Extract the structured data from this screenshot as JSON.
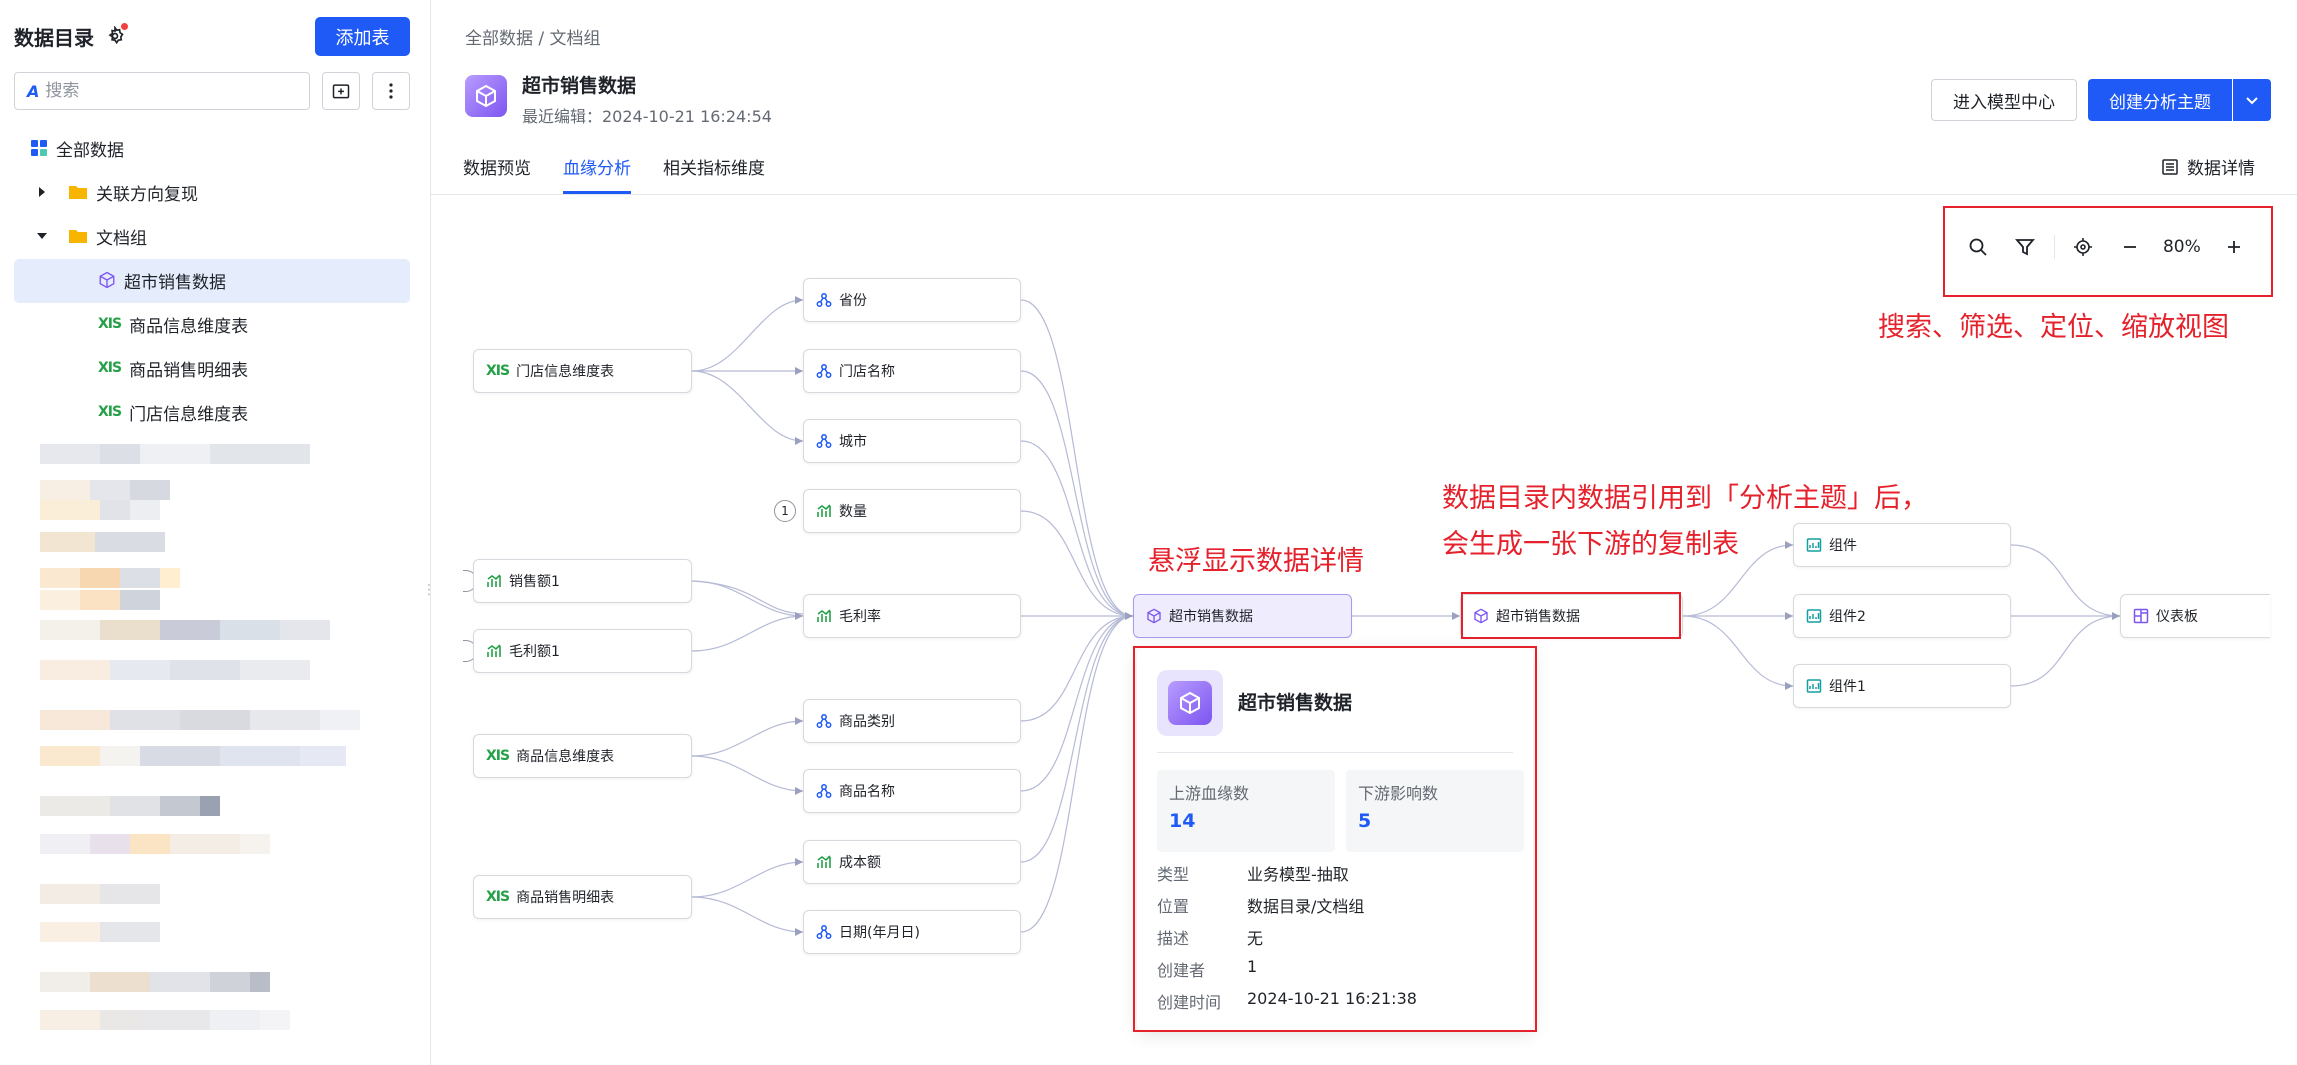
{
  "sidebar": {
    "title": "数据目录",
    "add_button": "添加表",
    "search_placeholder": "搜索",
    "tree": [
      {
        "label": "全部数据"
      },
      {
        "label": "关联方向复现"
      },
      {
        "label": "文档组"
      },
      {
        "label": "超市销售数据"
      },
      {
        "label": "商品信息维度表"
      },
      {
        "label": "商品销售明细表"
      },
      {
        "label": "门店信息维度表"
      }
    ],
    "xls_icon_text": "XIS"
  },
  "header": {
    "breadcrumb": "全部数据 / 文档组",
    "title": "超市销售数据",
    "subtitle": "最近编辑：2024-10-21 16:24:54",
    "btn_model": "进入模型中心",
    "btn_create": "创建分析主题"
  },
  "tabs": [
    {
      "label": "数据预览",
      "active": false
    },
    {
      "label": "血缘分析",
      "active": true
    },
    {
      "label": "相关指标维度",
      "active": false
    }
  ],
  "detail_link": "数据详情",
  "toolbar": {
    "zoom": "80%"
  },
  "annotations": {
    "toolbar_note": "搜索、筛选、定位、缩放视图",
    "hover_note": "悬浮显示数据详情",
    "copy_note_1": "数据目录内数据引用到「分析主题」后，",
    "copy_note_2": "会生成一张下游的复制表"
  },
  "graph": {
    "sources": [
      {
        "label": "门店信息维度表"
      },
      {
        "label": "销售额1"
      },
      {
        "label": "毛利额1"
      },
      {
        "label": "商品信息维度表"
      },
      {
        "label": "商品销售明细表"
      }
    ],
    "fields": [
      {
        "label": "省份"
      },
      {
        "label": "门店名称"
      },
      {
        "label": "城市"
      },
      {
        "label": "数量"
      },
      {
        "label": "毛利率"
      },
      {
        "label": "商品类别"
      },
      {
        "label": "商品名称"
      },
      {
        "label": "成本额"
      },
      {
        "label": "日期(年月日)"
      }
    ],
    "count_badge": "1",
    "center": "超市销售数据",
    "copy": "超市销售数据",
    "components": [
      {
        "label": "组件"
      },
      {
        "label": "组件2"
      },
      {
        "label": "组件1"
      }
    ],
    "dashboard": "仪表板"
  },
  "popup": {
    "title": "超市销售数据",
    "upstream_label": "上游血缘数",
    "upstream_value": "14",
    "downstream_label": "下游影响数",
    "downstream_value": "5",
    "rows": [
      {
        "k": "类型",
        "v": "业务模型-抽取"
      },
      {
        "k": "位置",
        "v": "数据目录/文档组"
      },
      {
        "k": "描述",
        "v": "无"
      },
      {
        "k": "创建者",
        "v": "1"
      },
      {
        "k": "创建时间",
        "v": "2024-10-21 16:21:38"
      }
    ]
  },
  "colors": {
    "accent": "#1f5af6",
    "annotation": "#e5212b",
    "center_node": "#eeecfd"
  }
}
